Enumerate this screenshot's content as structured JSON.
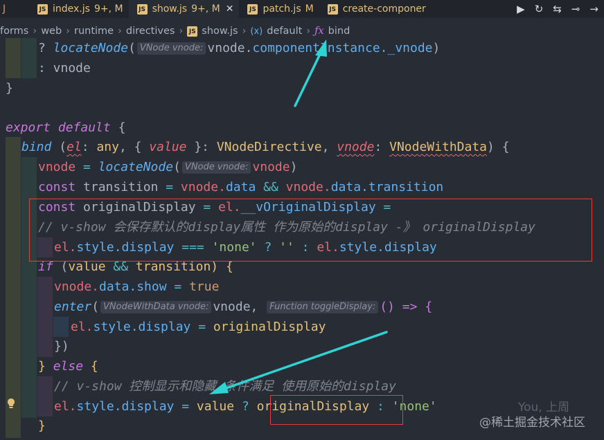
{
  "tabs": [
    {
      "stub": "J"
    },
    {
      "name": "index.js",
      "status": "9+, M"
    },
    {
      "name": "show.js",
      "status": "9+, M",
      "active": true
    },
    {
      "name": "patch.js",
      "status": "M"
    },
    {
      "name": "create-componer"
    }
  ],
  "tab_badge": "JS",
  "tab_close": "✕",
  "breadcrumb": [
    "forms",
    "web",
    "runtime",
    "directives",
    "show.js",
    "default",
    "bind"
  ],
  "breadcrumb_icons": {
    "var": "(x)",
    "fn": "ƒx"
  },
  "hints": {
    "vnode_a": "VNode vnode:",
    "vnode_b": "VNode vnode:",
    "vnode_c": "VNodeWithData vnode:",
    "toggle": "Function toggleDisplay:"
  },
  "code": {
    "l1_t": "? ",
    "l1_f": "locateNode",
    "l1_p": "(",
    "l1_e": "vnode.",
    "l1_m": "componentInstance._vnode",
    "l1_c": ")",
    "l2": ": vnode",
    "l3": "}",
    "l5_k1": "export",
    "l5_k2": "default",
    "l5_b": " {",
    "l6_f": "bind",
    "l6_p1": " (",
    "l6_v1": "el",
    "l6_p2": ": ",
    "l6_t1": "any",
    "l6_p3": ", { ",
    "l6_v2": "value",
    "l6_p4": " }: ",
    "l6_t2": "VNodeDirective",
    "l6_p5": ", ",
    "l6_v3": "vnode",
    "l6_p6": ": ",
    "l6_t3": "VNodeWithData",
    "l6_p7": ") {",
    "l7_a": "vnode",
    "l7_eq": " = ",
    "l7_f": "locateNode",
    "l7_p": "(",
    "l7_v": "vnode",
    "l7_c": ")",
    "l8_k": "const",
    "l8_v": " transition",
    "l8_eq": " = ",
    "l8_a": "vnode.",
    "l8_b": "data",
    "l8_and": " && ",
    "l8_c": "vnode.",
    "l8_d": "data.transition",
    "l9_k": "const",
    "l9_v": " originalDisplay",
    "l9_eq": " = ",
    "l9_a": "el.",
    "l9_b": "__vOriginalDisplay",
    "l9_eq2": " =",
    "l10": "// v-show 会保存默认的display属性 作为原始的display -》 originalDisplay",
    "l11_a": "el.",
    "l11_b": "style.display",
    "l11_op": " === ",
    "l11_s1": "'none'",
    "l11_q": " ? ",
    "l11_s2": "''",
    "l11_c": " : ",
    "l11_d": "el.",
    "l11_e": "style.display",
    "l12_k": "if",
    "l12_p": " (",
    "l12_v1": "value",
    "l12_and": " && ",
    "l12_v2": "transition",
    "l12_c": ") {",
    "l13_a": "vnode.",
    "l13_b": "data.show",
    "l13_eq": " = ",
    "l13_t": "true",
    "l14_f": "enter",
    "l14_p": "(",
    "l14_v": "vnode",
    "l14_cm": ", ",
    "l14_a": "() => {",
    "l15_a": "el.",
    "l15_b": "style.display",
    "l15_eq": " = ",
    "l15_v": "originalDisplay",
    "l16": "})",
    "l17_a": "} ",
    "l17_k": "else",
    "l17_b": " {",
    "l18": "// v-show 控制显示和隐藏 条件满足 使用原始的display",
    "l19_a": "el.",
    "l19_b": "style.display",
    "l19_eq": " = ",
    "l19_v": "value",
    "l19_q": " ? ",
    "l19_o": "originalDisplay",
    "l19_c": " : ",
    "l19_s": "'none'",
    "l20": "}"
  },
  "ghost_text": "You, 上周",
  "watermark": "@稀土掘金技术社区",
  "colors": {
    "annotation_red": "#e04040",
    "arrow_cyan": "#2fd3d3",
    "background": "#272c35"
  }
}
